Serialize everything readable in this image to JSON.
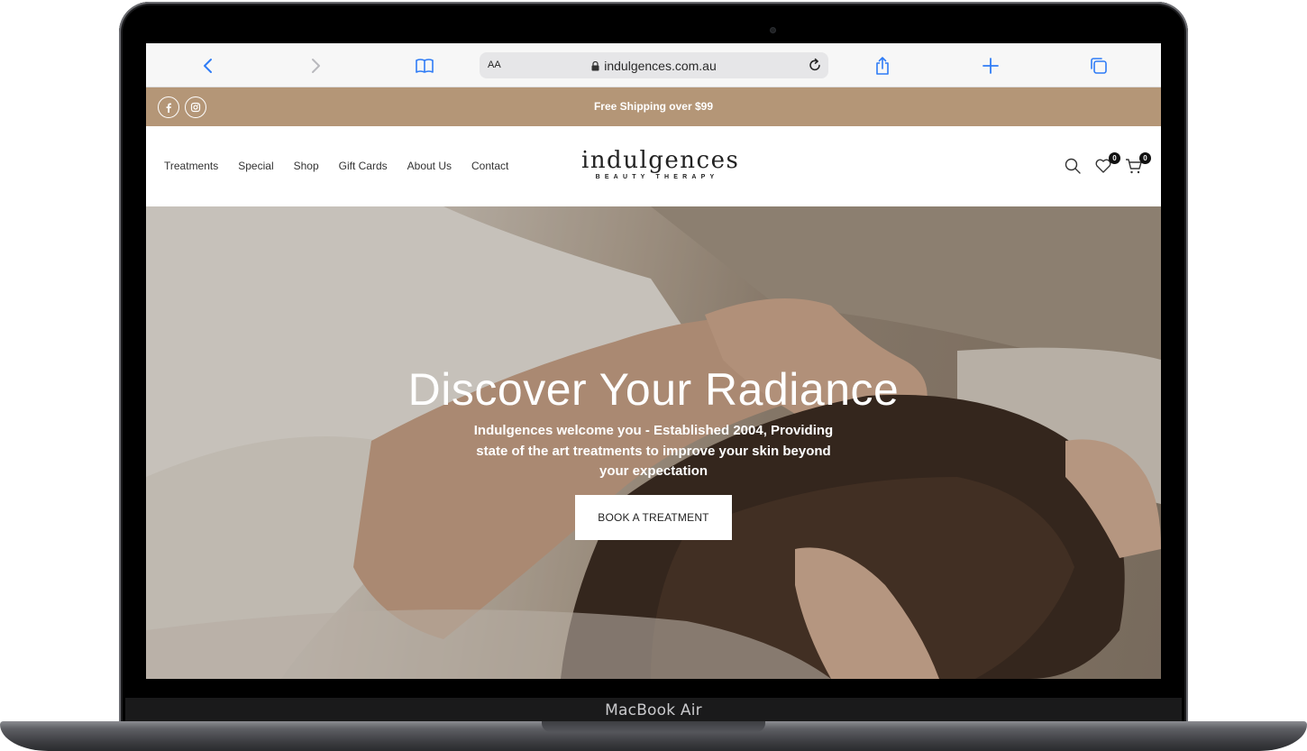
{
  "device": {
    "label": "MacBook Air"
  },
  "browser": {
    "reader_label": "AA",
    "url": "indulgences.com.au",
    "icons": [
      "back-icon",
      "forward-icon",
      "bookmarks-icon",
      "lock-icon",
      "reload-icon",
      "share-icon",
      "new-tab-icon",
      "tabs-icon"
    ]
  },
  "announcement": {
    "text": "Free Shipping over $99",
    "background": "#b49677",
    "social_icons": [
      "facebook-icon",
      "instagram-icon"
    ]
  },
  "nav": {
    "items": [
      "Treatments",
      "Special",
      "Shop",
      "Gift Cards",
      "About Us",
      "Contact"
    ]
  },
  "logo": {
    "name": "indulgences",
    "tagline": "BEAUTY THERAPY"
  },
  "header_icons": {
    "search": "search-icon",
    "wishlist": {
      "icon": "heart-icon",
      "count": "0"
    },
    "cart": {
      "icon": "cart-icon",
      "count": "0"
    }
  },
  "hero": {
    "title": "Discover Your Radiance",
    "subtitle": "Indulgences welcome you - Established 2004, Providing state of the art treatments to improve your skin beyond your expectation",
    "button_label": "BOOK A TREATMENT"
  }
}
